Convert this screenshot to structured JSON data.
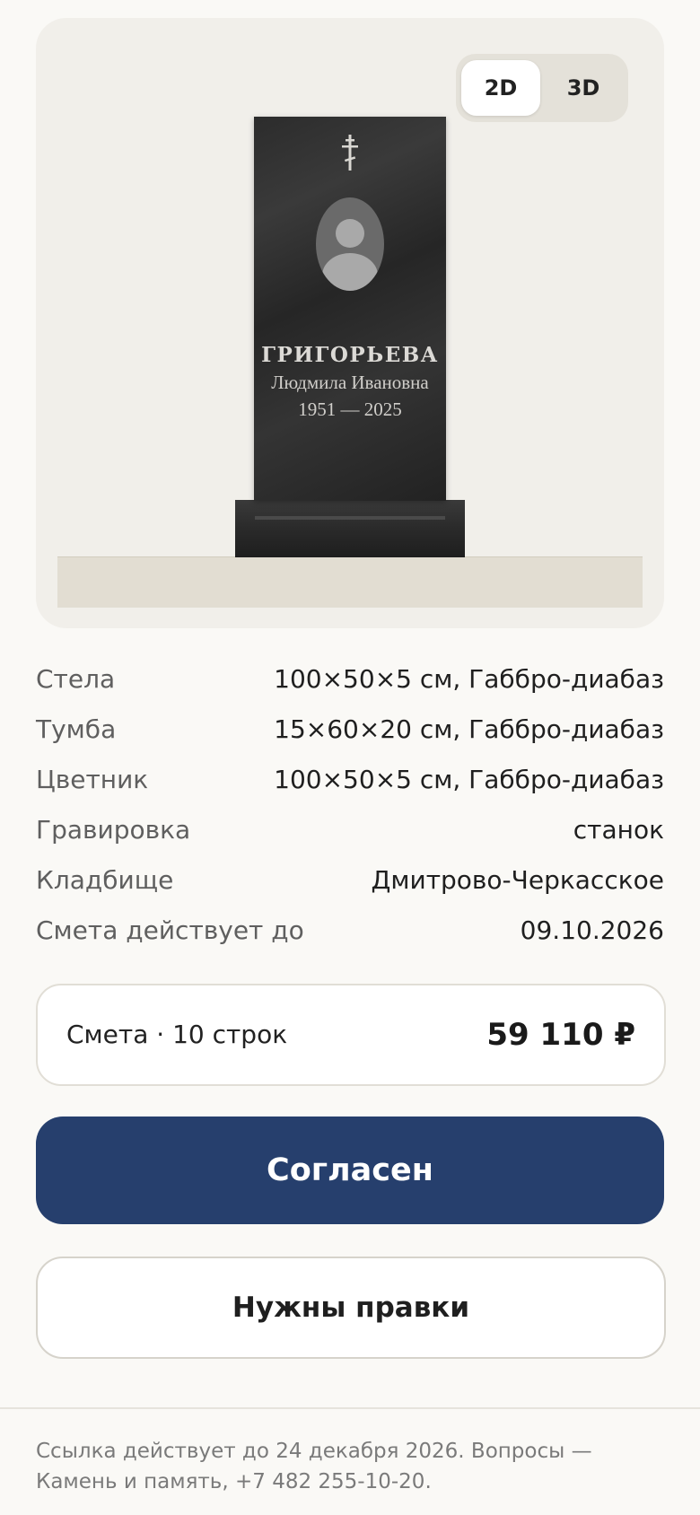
{
  "preview": {
    "view_toggle": {
      "options": [
        "2D",
        "3D"
      ],
      "selected": "2D"
    },
    "engraving": {
      "surname": "ГРИГОРЬЕВА",
      "given_names": "Людмила Ивановна",
      "years": "1951 — 2025"
    }
  },
  "specs": [
    {
      "label": "Стела",
      "value": "100×50×5 см, Габбро-диабаз"
    },
    {
      "label": "Тумба",
      "value": "15×60×20 см, Габбро-диабаз"
    },
    {
      "label": "Цветник",
      "value": "100×50×5 см, Габбро-диабаз"
    },
    {
      "label": "Гравировка",
      "value": "станок"
    },
    {
      "label": "Кладбище",
      "value": "Дмитрово-Черкасское"
    },
    {
      "label": "Смета действует до",
      "value": "09.10.2026"
    }
  ],
  "estimate": {
    "label": "Смета · 10 строк",
    "total": "59 110 ₽"
  },
  "actions": {
    "agree_label": "Согласен",
    "edits_label": "Нужны правки"
  },
  "footer": {
    "note": "Ссылка действует до 24 декабря 2026. Вопросы — Камень и память, +7 482 255-10-20."
  },
  "colors": {
    "background": "#faf9f6",
    "preview_card": "#f1efea",
    "primary_button": "#263f6d",
    "stone": "#2c2c2c"
  }
}
